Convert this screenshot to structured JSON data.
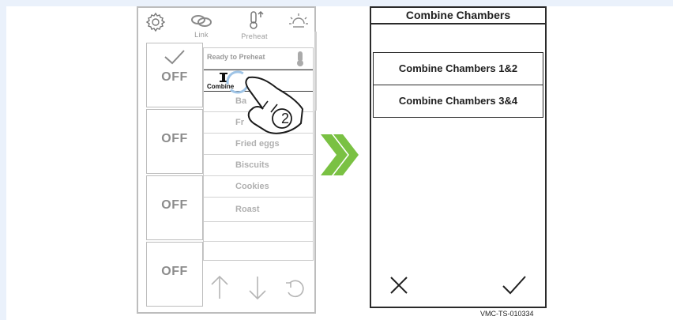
{
  "left": {
    "toolbar": {
      "settings_icon": "gear-icon",
      "link_label": "Link",
      "preheat_label": "Preheat",
      "brightness_icon": "sun-icon"
    },
    "off_label": "OFF",
    "list": {
      "status_text": "Ready to Preheat",
      "combine_label": "Combine",
      "items": [
        "Ba",
        "Fr",
        "Fried eggs",
        "Biscuits",
        "Cookies",
        "Roast"
      ]
    },
    "gesture_step": "2"
  },
  "right": {
    "title": "Combine Chambers",
    "options": [
      "Combine Chambers 1&2",
      "Combine Chambers 3&4"
    ],
    "cancel_icon": "close-icon",
    "confirm_icon": "check-icon"
  },
  "transition_icon": "double-chevron-right-icon",
  "reference_code": "VMC-TS-010334",
  "colors": {
    "accent_green": "#7ac143",
    "panel_border_left": "#bdbdbd",
    "panel_border_right": "#2a2a2a",
    "text_gray": "#9a9a9a"
  }
}
